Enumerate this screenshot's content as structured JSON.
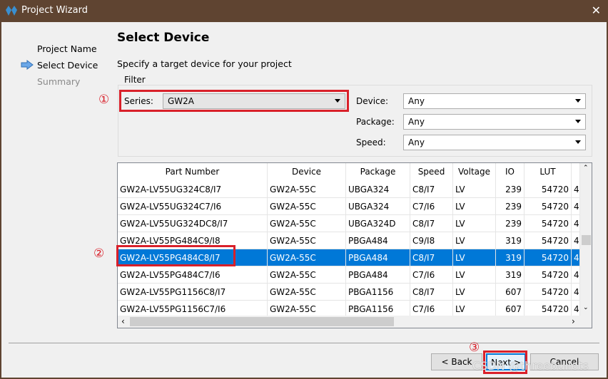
{
  "window": {
    "title": "Project Wizard",
    "close_glyph": "✕"
  },
  "sidebar": {
    "items": [
      {
        "label": "Project Name",
        "state": "done"
      },
      {
        "label": "Select Device",
        "state": "current"
      },
      {
        "label": "Summary",
        "state": "pending"
      }
    ]
  },
  "page": {
    "title": "Select Device",
    "subtitle": "Specify a target device for your project"
  },
  "filter": {
    "legend": "Filter",
    "series_label": "Series:",
    "series_value": "GW2A",
    "device_label": "Device:",
    "device_value": "Any",
    "package_label": "Package:",
    "package_value": "Any",
    "speed_label": "Speed:",
    "speed_value": "Any"
  },
  "table": {
    "columns": [
      "Part Number",
      "Device",
      "Package",
      "Speed",
      "Voltage",
      "IO",
      "LUT",
      ""
    ],
    "rows": [
      [
        "GW2A-LV55UG324C8/I7",
        "GW2A-55C",
        "UBGA324",
        "C8/I7",
        "LV",
        "239",
        "54720",
        "4"
      ],
      [
        "GW2A-LV55UG324C7/I6",
        "GW2A-55C",
        "UBGA324",
        "C7/I6",
        "LV",
        "239",
        "54720",
        "4"
      ],
      [
        "GW2A-LV55UG324DC8/I7",
        "GW2A-55C",
        "UBGA324D",
        "C8/I7",
        "LV",
        "239",
        "54720",
        "4"
      ],
      [
        "GW2A-LV55PG484C9/I8",
        "GW2A-55C",
        "PBGA484",
        "C9/I8",
        "LV",
        "319",
        "54720",
        "4"
      ],
      [
        "GW2A-LV55PG484C8/I7",
        "GW2A-55C",
        "PBGA484",
        "C8/I7",
        "LV",
        "319",
        "54720",
        "4"
      ],
      [
        "GW2A-LV55PG484C7/I6",
        "GW2A-55C",
        "PBGA484",
        "C7/I6",
        "LV",
        "319",
        "54720",
        "4"
      ],
      [
        "GW2A-LV55PG1156C8/I7",
        "GW2A-55C",
        "PBGA1156",
        "C8/I7",
        "LV",
        "607",
        "54720",
        "4"
      ],
      [
        "GW2A-LV55PG1156C7/I6",
        "GW2A-55C",
        "PBGA1156",
        "C7/I6",
        "LV",
        "607",
        "54720",
        "4"
      ]
    ],
    "selected_row": 4
  },
  "buttons": {
    "back": "< Back",
    "next": "Next >",
    "cancel": "Cancel"
  },
  "annotations": {
    "one": "①",
    "two": "②",
    "three": "③"
  },
  "watermark": "CSDN @threebullets",
  "colors": {
    "titlebar": "#5f4431",
    "selection": "#0078d7",
    "annotation": "#d9202a"
  }
}
